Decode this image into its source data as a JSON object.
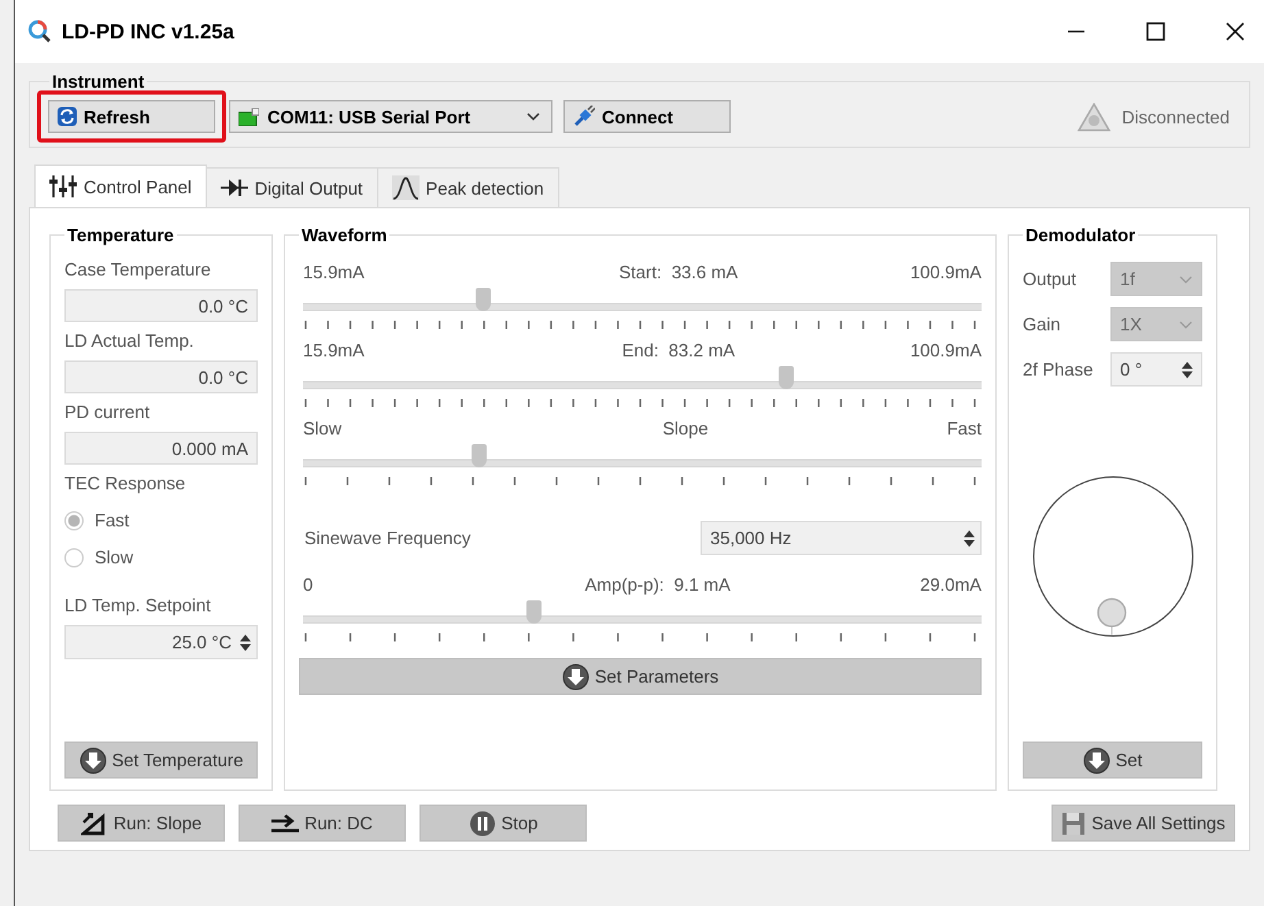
{
  "window": {
    "title": "LD-PD INC v1.25a"
  },
  "instrument": {
    "title": "Instrument",
    "refresh_button": {
      "label": "Refresh",
      "highlighted": true
    },
    "port_select": {
      "value": "COM11: USB Serial Port"
    },
    "connect_button": {
      "label": "Connect"
    },
    "status": "Disconnected"
  },
  "tabs": [
    {
      "label": "Control Panel",
      "selected": true,
      "kind": "sliders"
    },
    {
      "label": "Digital Output",
      "selected": false,
      "kind": "diode"
    },
    {
      "label": "Peak detection",
      "selected": false,
      "kind": "peak"
    }
  ],
  "temperature": {
    "title": "Temperature",
    "readouts": [
      {
        "label": "Case Temperature",
        "value": "0.0 °C"
      },
      {
        "label": "LD Actual Temp.",
        "value": "0.0 °C"
      },
      {
        "label": "PD current",
        "value": "0.000 mA"
      }
    ],
    "tec_response": {
      "label": "TEC Response",
      "options": [
        {
          "label": "Fast",
          "selected": true
        },
        {
          "label": "Slow",
          "selected": false
        }
      ]
    },
    "setpoint": {
      "label": "LD Temp. Setpoint",
      "value": "25.0 °C"
    },
    "set_button": "Set Temperature"
  },
  "waveform": {
    "title": "Waveform",
    "controls": [
      {
        "kind": "slider",
        "min": "15.9mA",
        "caption": "Start:",
        "reading": "33.6 mA",
        "max": "100.9mA",
        "level": 0.264
      },
      {
        "kind": "slider",
        "min": "15.9mA",
        "caption": "End:",
        "reading": "83.2 mA",
        "max": "100.9mA",
        "level": 0.711
      },
      {
        "kind": "slider",
        "min": "Slow",
        "caption": "Slope",
        "max": "Fast",
        "level": 0.258
      },
      {
        "kind": "spinbox",
        "label": "Sinewave Frequency",
        "value": "35,000 Hz"
      },
      {
        "kind": "slider",
        "min": "0",
        "caption": "Amp(p-p):",
        "reading": "9.1 mA",
        "max": "29.0mA",
        "level": 0.339
      }
    ],
    "set_button": "Set Parameters"
  },
  "demodulator": {
    "title": "Demodulator",
    "fields": [
      {
        "kind": "dropdown",
        "label": "Output",
        "value": "1f",
        "disabled": true
      },
      {
        "kind": "dropdown",
        "label": "Gain",
        "value": "1X",
        "disabled": true
      },
      {
        "kind": "spinbox",
        "label": "2f Phase",
        "value": "0 °",
        "disabled": false
      }
    ],
    "set_button": "Set"
  },
  "footer_buttons": [
    {
      "label": "Run: Slope",
      "kind": "slope"
    },
    {
      "label": "Run: DC",
      "kind": "dc"
    },
    {
      "label": "Stop",
      "kind": "stop"
    }
  ],
  "save_button": "Save All Settings"
}
